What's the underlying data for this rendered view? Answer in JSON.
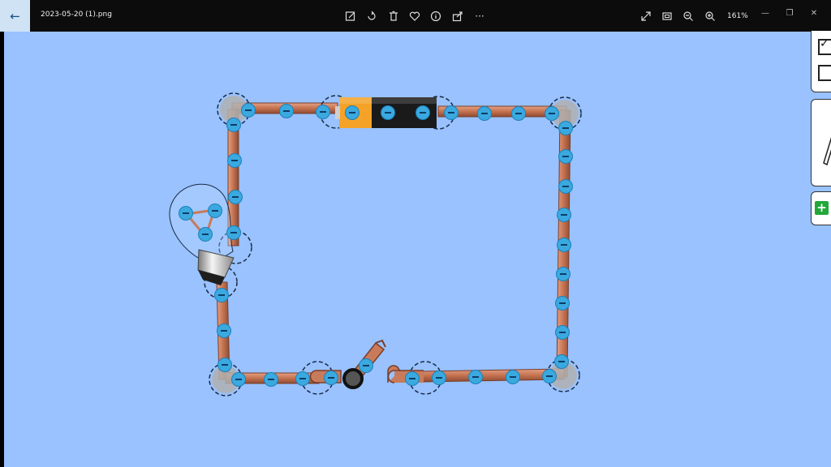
{
  "title_bar": {
    "back_icon": "arrow-left-icon",
    "file_name": "2023-05-20 (1).png",
    "toolbar_icons": [
      "edit-icon",
      "rotate-icon",
      "delete-icon",
      "heart-icon",
      "info-icon",
      "share-icon",
      "more-icon"
    ],
    "right_icons": [
      "expand-icon",
      "fit-icon",
      "zoom-out-icon",
      "zoom-in-icon"
    ],
    "zoom_level": "161%",
    "window_controls": [
      "minimize-icon",
      "restore-icon",
      "close-icon"
    ],
    "more_glyph": "···"
  },
  "colors": {
    "canvas_bg": "#99c2ff",
    "wire": "#c87b5a",
    "electron": "#3aa9e0",
    "battery_orange": "#f4a328",
    "battery_black": "#1a1a1a"
  },
  "circuit": {
    "components": [
      "battery",
      "light-bulb",
      "switch-open",
      "wires"
    ],
    "switch_state": "open"
  },
  "side_panel": {
    "items": [
      "checkbox-checked",
      "checkbox-unchecked",
      "pencil-tool",
      "add-button"
    ],
    "add_glyph": "+"
  }
}
